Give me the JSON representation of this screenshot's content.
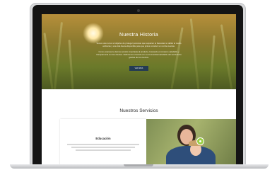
{
  "hero": {
    "title": "Nuestra Historia",
    "paragraph": [
      "Somos una red en el objetivo de proteger personas que requieren el bienestar no dañar el medio",
      "ambiente y una vida buena disponible para que juntos construir un red de cuentas.",
      "Como empresa te damos servicio importante al producto, buscando el consumo saludable y",
      "transparencia con los clientes. Definiremos creando con su Comunidad saludable del sentimiento",
      "gracias de los cuentos."
    ],
    "button_label": "VER MAS"
  },
  "services": {
    "title": "Nuestros Servicios",
    "card_title": "Educación"
  }
}
